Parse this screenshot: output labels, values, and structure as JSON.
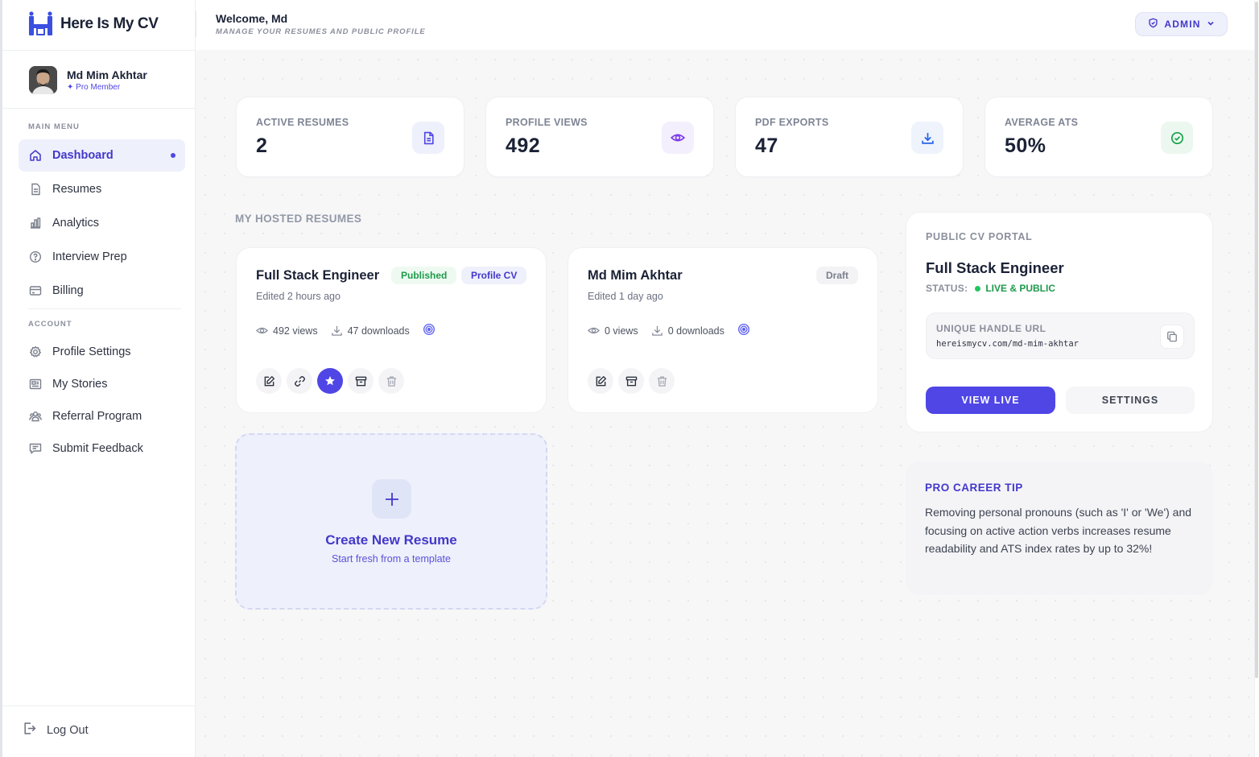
{
  "brand": {
    "name": "Here Is My CV"
  },
  "header": {
    "welcome": "Welcome, Md",
    "subtitle": "MANAGE YOUR RESUMES AND PUBLIC PROFILE",
    "role_button": "ADMIN"
  },
  "user": {
    "name": "Md Mim Akhtar",
    "badge": "✦ Pro Member"
  },
  "sidebar": {
    "main_heading": "MAIN MENU",
    "main_items": [
      {
        "label": "Dashboard",
        "icon": "home-icon",
        "active": true
      },
      {
        "label": "Resumes",
        "icon": "document-icon"
      },
      {
        "label": "Analytics",
        "icon": "bar-chart-icon"
      },
      {
        "label": "Interview Prep",
        "icon": "question-circle-icon"
      },
      {
        "label": "Billing",
        "icon": "credit-card-icon"
      }
    ],
    "account_heading": "ACCOUNT",
    "account_items": [
      {
        "label": "Profile Settings",
        "icon": "gear-icon"
      },
      {
        "label": "My Stories",
        "icon": "newspaper-icon"
      },
      {
        "label": "Referral Program",
        "icon": "users-icon"
      },
      {
        "label": "Submit Feedback",
        "icon": "message-icon"
      }
    ],
    "logout": "Log Out"
  },
  "stats": [
    {
      "label": "ACTIVE RESUMES",
      "value": "2",
      "icon": "document-icon",
      "color": "#4f46e5",
      "bg": "#eef0fb"
    },
    {
      "label": "PROFILE VIEWS",
      "value": "492",
      "icon": "eye-icon",
      "color": "#7c3aed",
      "bg": "#f3effc"
    },
    {
      "label": "PDF EXPORTS",
      "value": "47",
      "icon": "download-icon",
      "color": "#2563eb",
      "bg": "#eef3fc"
    },
    {
      "label": "AVERAGE ATS",
      "value": "50%",
      "icon": "check-circle-icon",
      "color": "#16a34a",
      "bg": "#ecf8ef"
    }
  ],
  "resumes_heading": "MY HOSTED RESUMES",
  "resumes": [
    {
      "title": "Full Stack Engineer",
      "edited": "Edited 2 hours ago",
      "badges": [
        "Published",
        "Profile CV"
      ],
      "views": "492 views",
      "downloads": "47 downloads"
    },
    {
      "title": "Md Mim Akhtar",
      "edited": "Edited 1 day ago",
      "badges": [
        "Draft"
      ],
      "views": "0 views",
      "downloads": "0 downloads"
    }
  ],
  "create": {
    "title": "Create New Resume",
    "subtitle": "Start fresh from a template"
  },
  "portal": {
    "heading": "PUBLIC CV PORTAL",
    "title": "Full Stack Engineer",
    "status_label": "STATUS:",
    "status_value": "LIVE & PUBLIC",
    "url_label": "UNIQUE HANDLE URL",
    "url_value": "hereismycv.com/md-mim-akhtar",
    "view_live": "VIEW LIVE",
    "settings": "SETTINGS"
  },
  "tip": {
    "heading": "PRO CAREER TIP",
    "body": "Removing personal pronouns (such as 'I' or 'We') and focusing on active action verbs increases resume readability and ATS index rates by up to 32%!"
  }
}
